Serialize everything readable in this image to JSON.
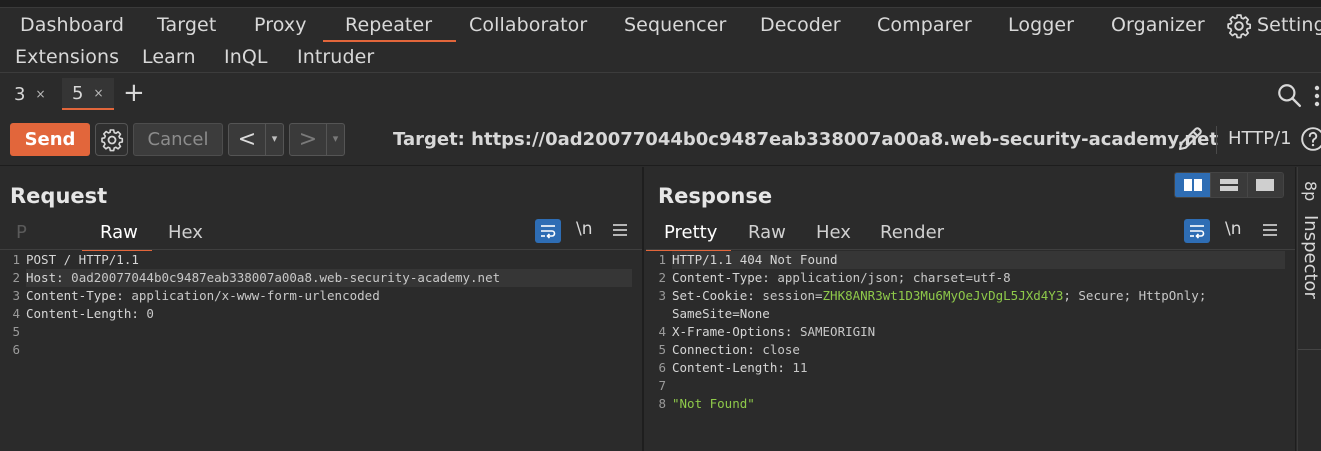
{
  "nav": {
    "row1": [
      "Dashboard",
      "Target",
      "Proxy",
      "Repeater",
      "Collaborator",
      "Sequencer",
      "Decoder",
      "Comparer",
      "Logger",
      "Organizer",
      "Settings"
    ],
    "row2": [
      "Extensions",
      "Learn",
      "InQL",
      "Intruder"
    ],
    "active": "Repeater"
  },
  "tabs": {
    "items": [
      {
        "label": "3",
        "close": "×"
      },
      {
        "label": "5",
        "close": "×"
      }
    ],
    "active": "5",
    "add": "+"
  },
  "toolbar": {
    "send_label": "Send",
    "cancel_label": "Cancel",
    "prev_label": "<",
    "next_label": ">",
    "dropdown_glyph": "▾",
    "target_label": "Target: https://0ad20077044b0c9487eab338007a00a8.web-security-academy.net",
    "http_label": "HTTP/1"
  },
  "request": {
    "title": "Request",
    "tabs": [
      "P",
      "Raw",
      "Hex"
    ],
    "active_tab": "Raw",
    "newline_label": "\\n",
    "lines": [
      {
        "n": "1",
        "name": "",
        "value": "POST / HTTP/1.1"
      },
      {
        "n": "2",
        "name": "Host:",
        "value": " 0ad20077044b0c9487eab338007a00a8.web-security-academy.net"
      },
      {
        "n": "3",
        "name": "Content-Type:",
        "value": " application/x-www-form-urlencoded"
      },
      {
        "n": "4",
        "name": "Content-Length:",
        "value": " 0"
      },
      {
        "n": "5",
        "name": "",
        "value": ""
      },
      {
        "n": "6",
        "name": "",
        "value": ""
      }
    ]
  },
  "response": {
    "title": "Response",
    "tabs": [
      "Pretty",
      "Raw",
      "Hex",
      "Render"
    ],
    "active_tab": "Pretty",
    "newline_label": "\\n",
    "lines": {
      "l1": {
        "n": "1",
        "value": "HTTP/1.1 404 Not Found"
      },
      "l2": {
        "n": "2",
        "name": "Content-Type:",
        "value": " application/json; charset=utf-8"
      },
      "l3": {
        "n": "3",
        "name": "Set-Cookie:",
        "pre": " session=",
        "cookie": "ZHK8ANR3wt1D3Mu6MyOeJvDgL5JXd4Y3",
        "post": "; Secure; HttpOnly;",
        "cont": "SameSite=None"
      },
      "l4": {
        "n": "4",
        "name": "X-Frame-Options:",
        "value": " SAMEORIGIN"
      },
      "l5": {
        "n": "5",
        "name": "Connection:",
        "value": " close"
      },
      "l6": {
        "n": "6",
        "name": "Content-Length:",
        "value": " 11"
      },
      "l7": {
        "n": "7",
        "value": ""
      },
      "l8": {
        "n": "8",
        "value": "\"Not Found\""
      }
    }
  },
  "inspector": {
    "label": "Inspector",
    "top_glyph": "8p"
  },
  "colors": {
    "accent": "#e2663b",
    "blue": "#2e6db4",
    "bg": "#2b2b2b",
    "green_value": "#8ec94a"
  }
}
